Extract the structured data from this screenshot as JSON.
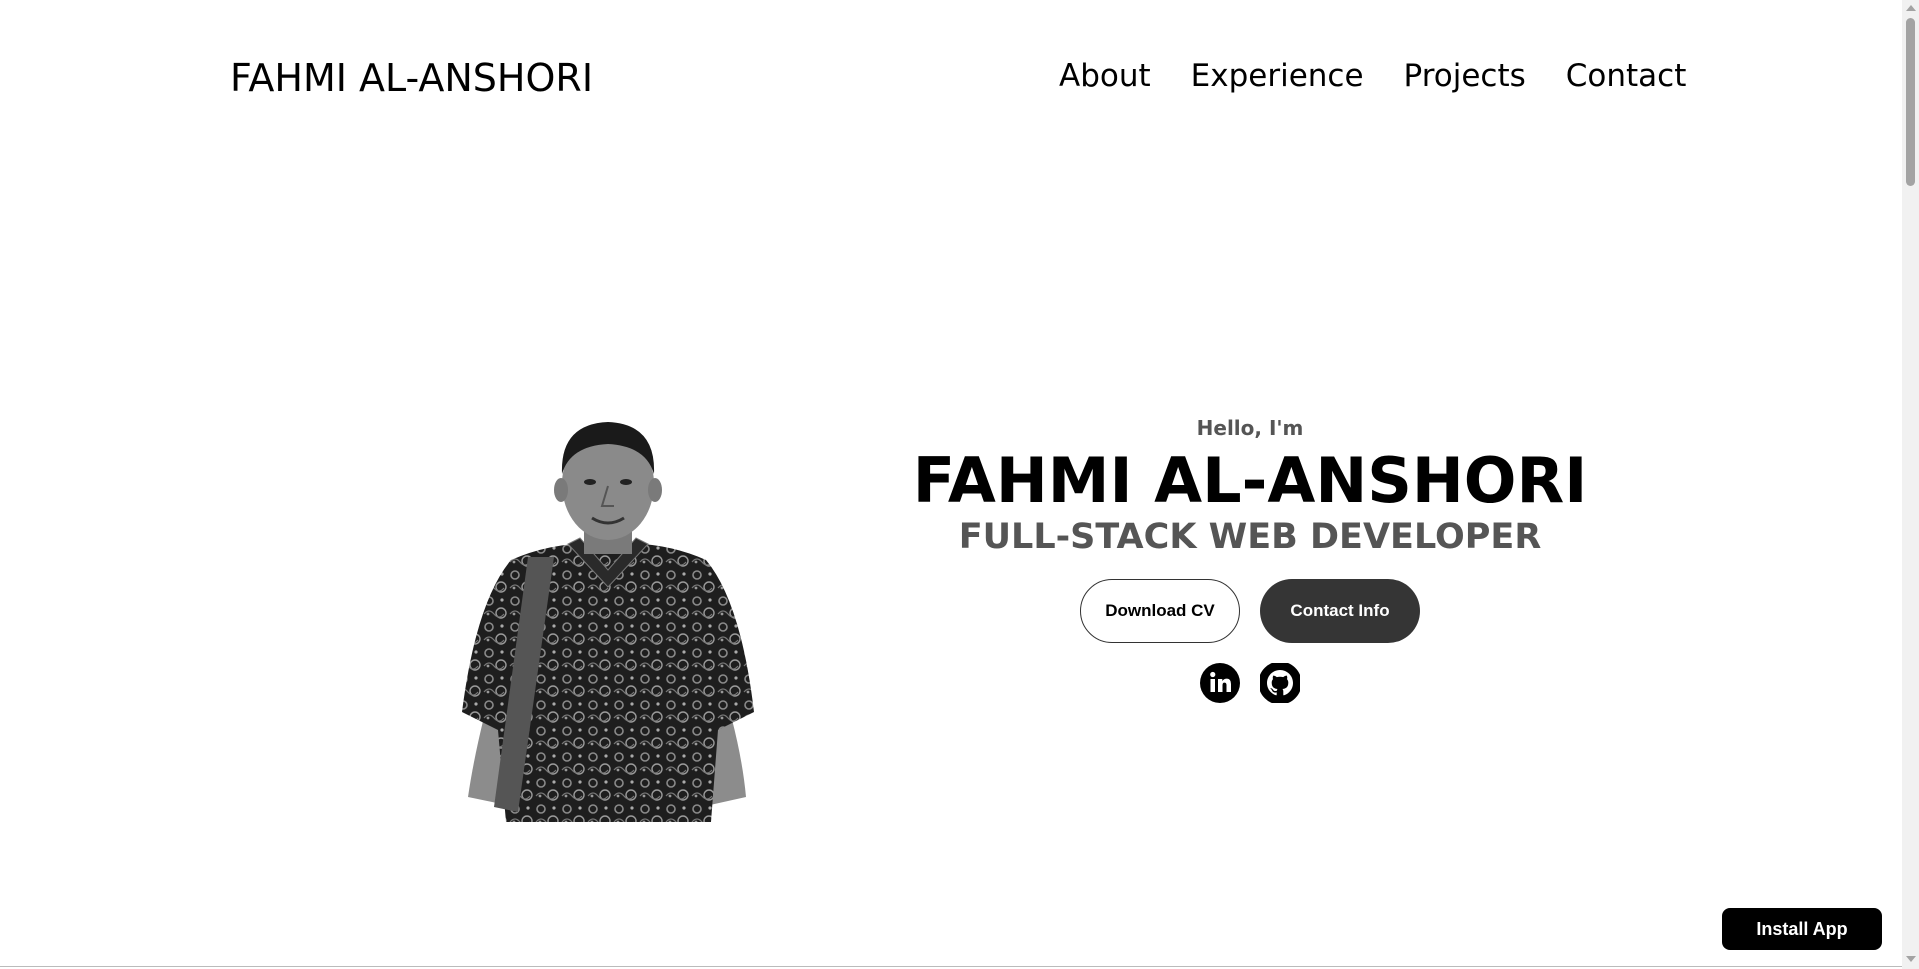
{
  "nav": {
    "logo": "FAHMI AL-ANSHORI",
    "links": [
      "About",
      "Experience",
      "Projects",
      "Contact"
    ]
  },
  "hero": {
    "greeting": "Hello, I'm",
    "name": "FAHMI AL-ANSHORI",
    "role": "FULL-STACK WEB DEVELOPER",
    "download_cv_label": "Download CV",
    "contact_info_label": "Contact Info",
    "social_icons": [
      "linkedin-icon",
      "github-icon"
    ]
  },
  "install_app_label": "Install App",
  "colors": {
    "background": "#ffffff",
    "text": "#000000",
    "muted_text": "#555555",
    "filled_button": "#353535",
    "install_button": "#000000"
  }
}
